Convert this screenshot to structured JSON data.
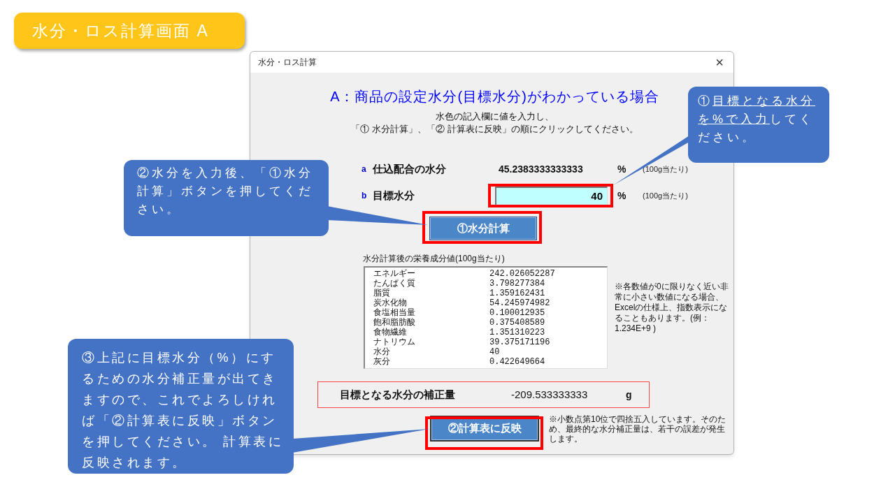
{
  "slide_title": "水分・ロス計算画面 A",
  "window": {
    "title": "水分・ロス計算",
    "close": "×"
  },
  "heading": "A：商品の設定水分(目標水分)がわかっている場合",
  "instructions": [
    "水色の記入欄に値を入力し、",
    "「① 水分計算」、「② 計算表に反映」の順にクリックしてください。"
  ],
  "fields": [
    {
      "letter": "a",
      "label": "仕込配合の水分",
      "kind": "readout",
      "value": "45.2383333333333",
      "unit": "%",
      "note": "(100g当たり)"
    },
    {
      "letter": "b",
      "label": "目標水分",
      "kind": "input",
      "value": "40",
      "unit": "%",
      "note": "(100g当たり)"
    }
  ],
  "calc_button": "①水分計算",
  "nutrients": {
    "label": "水分計算後の栄養成分値(100g当たり)",
    "rows": [
      {
        "name": "エネルギー",
        "value": "242.026052287"
      },
      {
        "name": "たんぱく質",
        "value": "3.798277384"
      },
      {
        "name": "脂質",
        "value": "1.359162431"
      },
      {
        "name": "炭水化物",
        "value": "54.245974982"
      },
      {
        "name": "食塩相当量",
        "value": "0.100012935"
      },
      {
        "name": "飽和脂肪酸",
        "value": "0.375408589"
      },
      {
        "name": "食物繊維",
        "value": "1.351310223"
      },
      {
        "name": "ナトリウム",
        "value": "39.375171196"
      },
      {
        "name": "水分",
        "value": "40"
      },
      {
        "name": "灰分",
        "value": "0.422649664"
      }
    ],
    "note": "※各数値が0に限りなく近い非常に小さい数値になる場合、Excelの仕様上、指数表示になることもあります。(例：1.234E+9 )"
  },
  "correction": {
    "label": "目標となる水分の補正量",
    "value": "-209.533333333",
    "unit": "g"
  },
  "apply_button": "②計算表に反映",
  "rounding_note": "※小数点第10位で四捨五入しています。そのため、最終的な水分補正量は、若干の誤差が発生します。",
  "callouts": [
    {
      "segments": [
        {
          "text": "①",
          "underline": false
        },
        {
          "text": "目標となる水分を%で入力",
          "underline": true
        },
        {
          "text": "してください。",
          "underline": false
        }
      ]
    },
    {
      "segments": [
        {
          "text": "②水分を入力後、「①水分計算」ボタンを押してください。",
          "underline": false
        }
      ]
    },
    {
      "segments": [
        {
          "text": "③上記に目標水分（%）にするための水分補正量が出てきますので、これでよろしければ「②計算表に反映」ボタンを押してください。 計算表に反映されます。",
          "underline": false
        }
      ]
    }
  ]
}
